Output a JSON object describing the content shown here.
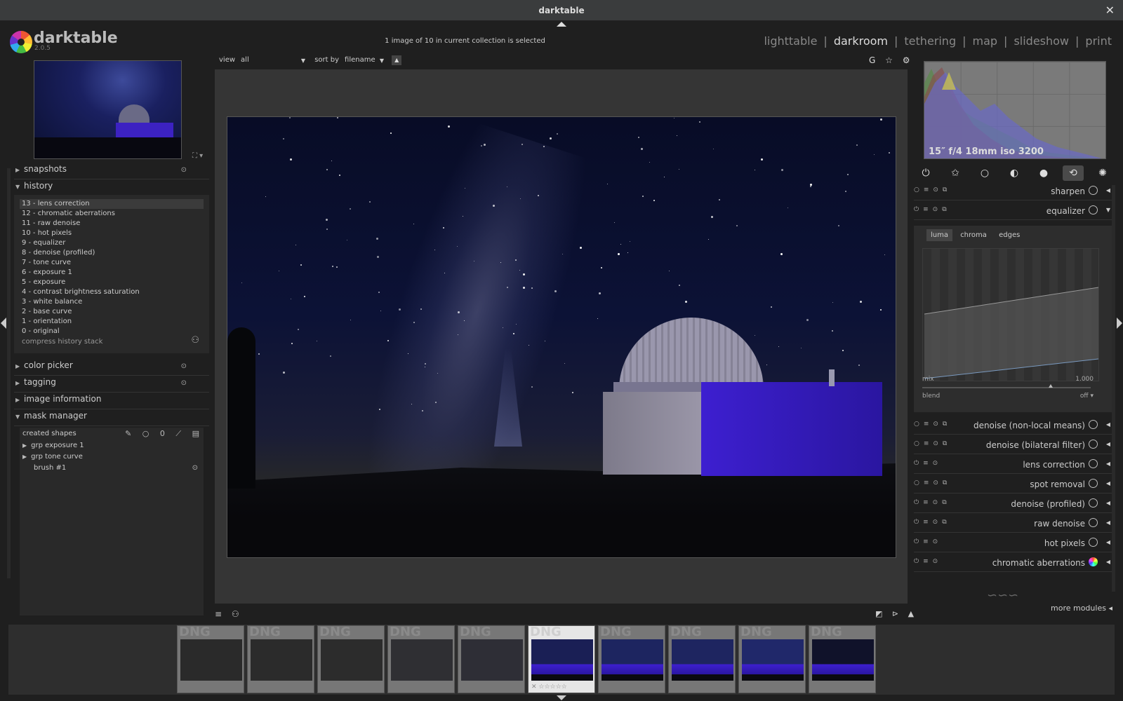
{
  "window": {
    "title": "darktable",
    "close_glyph": "✕"
  },
  "app": {
    "name": "darktable",
    "version": "2.0.5"
  },
  "header": {
    "selection_info": "1 image of 10 in current collection is selected",
    "views": [
      "lighttable",
      "darkroom",
      "tethering",
      "map",
      "slideshow",
      "print"
    ],
    "active_view": "darkroom",
    "separator": "|"
  },
  "left_panel": {
    "snapshots": {
      "label": "snapshots"
    },
    "history": {
      "label": "history",
      "items": [
        "13 - lens correction",
        "12 - chromatic aberrations",
        "11 - raw denoise",
        "10 - hot pixels",
        "9 - equalizer",
        "8 - denoise (profiled)",
        "7 - tone curve",
        "6 - exposure 1",
        "5 - exposure",
        "4 - contrast brightness saturation",
        "3 - white balance",
        "2 - base curve",
        "1 - orientation",
        "0 - original"
      ],
      "selected_index": 0,
      "compress_label": "compress history stack"
    },
    "color_picker": {
      "label": "color picker"
    },
    "tagging": {
      "label": "tagging"
    },
    "image_information": {
      "label": "image information"
    },
    "mask_manager": {
      "label": "mask manager",
      "created_shapes_label": "created shapes",
      "rows": [
        "grp exposure 1",
        "grp tone curve"
      ],
      "brush_label": "brush #1"
    }
  },
  "center": {
    "view_label": "view",
    "view_value": "all",
    "sort_label": "sort by",
    "sort_value": "filename",
    "top_icons": [
      "G",
      "☆",
      "⚙"
    ]
  },
  "right_panel": {
    "exif": "15″ f/4 18mm iso 3200",
    "group_tab_active_index": 5,
    "modules": {
      "sharpen": "sharpen",
      "equalizer": "equalizer",
      "denoise_nlm": "denoise (non-local means)",
      "denoise_bilateral": "denoise (bilateral filter)",
      "lens_correction": "lens correction",
      "spot_removal": "spot removal",
      "denoise_profiled": "denoise (profiled)",
      "raw_denoise": "raw denoise",
      "hot_pixels": "hot pixels",
      "chromatic_aberrations": "chromatic aberrations"
    },
    "equalizer": {
      "tabs": [
        "luma",
        "chroma",
        "edges"
      ],
      "active_tab": "luma",
      "mix_label": "mix",
      "mix_value": "1.000",
      "blend_label": "blend",
      "blend_value": "off"
    },
    "more_modules": "more modules"
  },
  "filmstrip": {
    "count": 10,
    "selected_index": 5,
    "badge_text": "DNG"
  },
  "colors": {
    "accent_sky": "#0c1236",
    "observatory_blue": "#3d1fd0"
  }
}
